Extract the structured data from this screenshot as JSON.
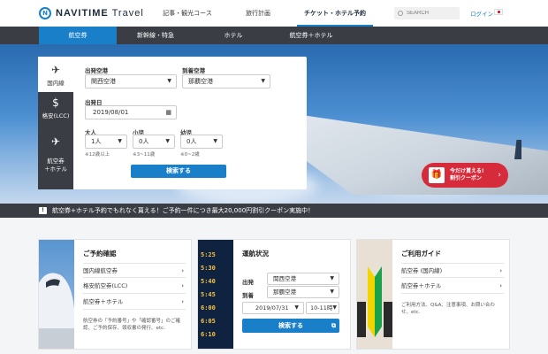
{
  "header": {
    "logo_mark": "N",
    "logo_brand": "NAVITIME",
    "logo_suffix": "Travel",
    "nav": [
      {
        "label": "記事・観光コース"
      },
      {
        "label": "旅行計画"
      },
      {
        "label": "チケット・ホテル予約"
      }
    ],
    "search_placeholder": "SEARCH",
    "login": "ログイン"
  },
  "subnav": [
    "航空券",
    "新幹線・特急",
    "ホテル",
    "航空券＋ホテル"
  ],
  "booking": {
    "tabs": [
      {
        "label": "国内線",
        "icon": "plane-icon"
      },
      {
        "label": "格安(LCC)",
        "icon": "dollar-icon"
      },
      {
        "label": "航空券\n＋ホテル",
        "icon": "plane-hotel-icon"
      }
    ],
    "depart_label": "出発空港",
    "depart_value": "関西空港",
    "arrive_label": "到着空港",
    "arrive_value": "那覇空港",
    "date_label": "出発日",
    "date_value": "2019/08/01",
    "adult_label": "大人",
    "adult_value": "1人",
    "adult_note": "※12歳以上",
    "child_label": "小児",
    "child_value": "0人",
    "child_note": "※3~11歳",
    "infant_label": "幼児",
    "infant_value": "0人",
    "infant_note": "※0~2歳",
    "search_button": "検索する"
  },
  "coupon": {
    "line1": "今だけ貰える!",
    "line2": "割引クーポン"
  },
  "notice": {
    "icon": "!",
    "text": "航空券+ホテル予約でもれなく貰える！ご予約一件につき最大20,000円割引クーポン実施中！"
  },
  "cards": {
    "reservation": {
      "title": "ご予約確認",
      "links": [
        "国内線航空券",
        "格安航空券(LCC)",
        "航空券＋ホテル"
      ],
      "note": "航空券の「予約番号」や「確認番号」のご確認、ご予約保存、領収書の発行、etc."
    },
    "status": {
      "title": "運航状況",
      "depart_label": "出発",
      "depart_value": "関西空港",
      "arrive_label": "到着",
      "arrive_value": "那覇空港",
      "date_value": "2019/07/31",
      "time_value": "10-11時",
      "search_button": "検索する",
      "board_text": [
        "5:25",
        "5:30",
        "5:40",
        "5:45",
        "6:00",
        "6:05",
        "6:10"
      ]
    },
    "guide": {
      "title": "ご利用ガイド",
      "links": [
        "航空券 (国内線)",
        "航空券＋ホテル"
      ],
      "note": "ご利用方法、Q&A、注意事項、お問い合わせ、etc."
    }
  },
  "colors": {
    "accent": "#1a7fc9",
    "dark_bar": "#3a3d44",
    "coupon": "#d52b3a"
  }
}
